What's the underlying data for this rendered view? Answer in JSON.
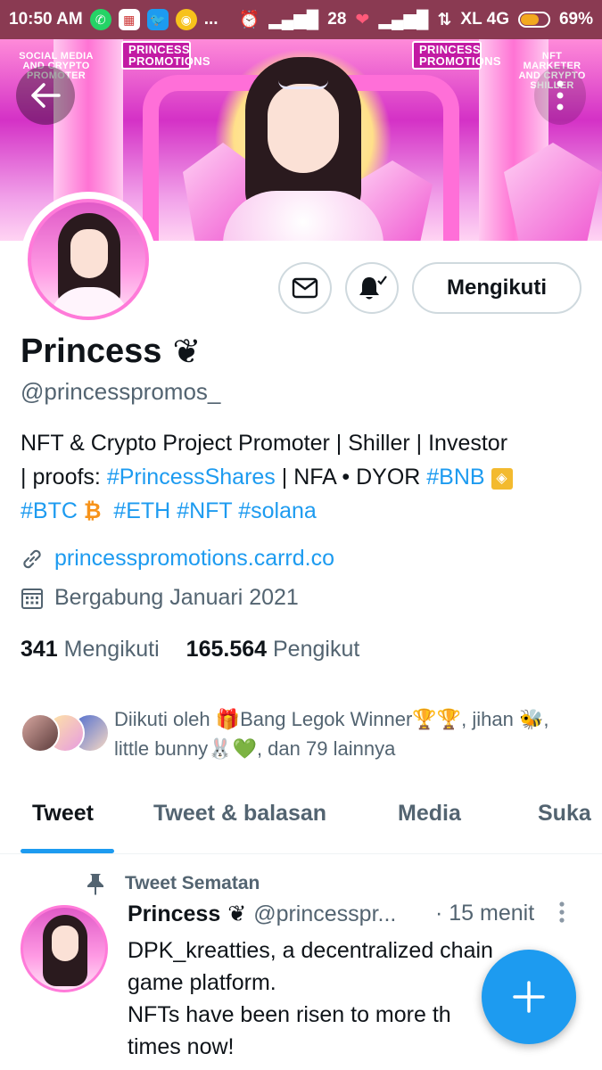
{
  "status_bar": {
    "time": "10:50 AM",
    "dots": "...",
    "signal_value": "28",
    "network": "XL 4G",
    "battery": "69%",
    "battery_level": 0.69
  },
  "banner": {
    "badge_left": "SOCIAL MEDIA AND CRYPTO PROMOTER",
    "badge_center_left": "PRINCESS PROMOTIONS",
    "badge_center_right": "PRINCESS PROMOTIONS",
    "badge_right": "NFT MARKETER AND CRYPTO SHILLER"
  },
  "profile": {
    "name": "Princess",
    "name_emoji": "❦",
    "handle": "@princesspromos_",
    "bio_parts": {
      "line1": "NFT & Crypto Project Promoter | Shiller | Investor",
      "line2_a": "| proofs: ",
      "tag_shares": "#PrincessShares",
      "line2_b": " | NFA • DYOR ",
      "tag_bnb": "#BNB",
      "tag_btc": "#BTC",
      "tag_eth": "#ETH",
      "tag_nft": "#NFT",
      "tag_solana": "#solana"
    },
    "link": "princesspromotions.carrd.co",
    "joined": "Bergabung Januari 2021",
    "following_count": "341",
    "following_label": "Mengikuti",
    "followers_count": "165.564",
    "followers_label": "Pengikut",
    "followed_by": "Diikuti oleh 🎁Bang Legok Winner🏆🏆, jihan 🐝, little bunny🐰💚, dan 79 lainnya"
  },
  "actions": {
    "follow_label": "Mengikuti"
  },
  "tabs": [
    {
      "label": "Tweet"
    },
    {
      "label": "Tweet & balasan"
    },
    {
      "label": "Media"
    },
    {
      "label": "Suka"
    }
  ],
  "tweet": {
    "pinned_label": "Tweet Sematan",
    "author": "Princess",
    "author_emoji": "❦",
    "handle": "@princesspr...",
    "time": "· 15 menit",
    "lines": [
      "DPK_kreatties, a decentralized chain",
      "game platform.",
      "NFTs have been risen to more th",
      "times now!"
    ]
  },
  "colors": {
    "accent": "#1d9bf0",
    "status_bar": "#8a3a52",
    "text_secondary": "#536471"
  }
}
